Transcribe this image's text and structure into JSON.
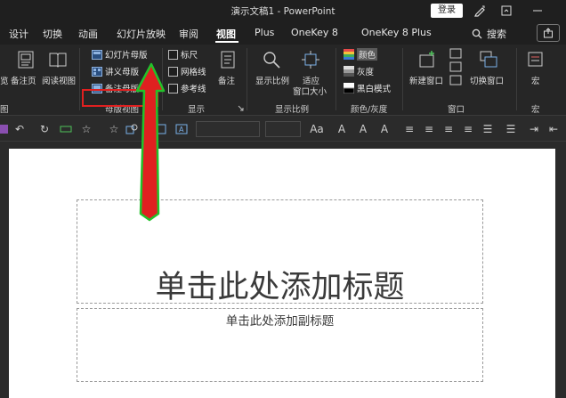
{
  "titlebar": {
    "title": "演示文稿1  -  PowerPoint",
    "login": "登录"
  },
  "tabs": [
    {
      "label": "设计"
    },
    {
      "label": "切换"
    },
    {
      "label": "动画"
    },
    {
      "label": "幻灯片放映"
    },
    {
      "label": "审阅"
    },
    {
      "label": "视图"
    },
    {
      "label": "Plus"
    },
    {
      "label": "OneKey 8"
    },
    {
      "label": "OneKey 8 Plus"
    },
    {
      "label": "搜索"
    }
  ],
  "ribbon": {
    "views": {
      "truncated": "览",
      "notes_page": "备注页",
      "reading_view": "阅读视图",
      "group_label_trunc": "图"
    },
    "master": {
      "slide_master": "幻灯片母版",
      "handout_master": "讲义母版",
      "notes_master": "备注母版",
      "group_label": "母版视图"
    },
    "show": {
      "ruler": "标尺",
      "gridlines": "网格线",
      "guides": "参考线",
      "group_label": "显示"
    },
    "notes": {
      "label": "备注"
    },
    "zoom": {
      "zoom": "显示比例",
      "fit_line1": "适应",
      "fit_line2": "窗口大小",
      "group_label": "显示比例"
    },
    "color": {
      "color": "颜色",
      "grayscale": "灰度",
      "bw": "黑白模式",
      "group_label": "颜色/灰度"
    },
    "window": {
      "new_window": "新建窗口",
      "switch_window": "切换窗口",
      "group_label": "窗口"
    },
    "macros": {
      "label": "宏",
      "group_label": "宏"
    }
  },
  "slide": {
    "title": "单击此处添加标题",
    "subtitle": "单击此处添加副标题"
  },
  "colors": {
    "highlight": "#e02020",
    "arrow_fill": "#e02020",
    "arrow_stroke": "#22c22a"
  },
  "icons": [
    "save-icon",
    "undo-icon",
    "redo-icon",
    "star-icon",
    "search-icon",
    "share-icon",
    "dialog-launcher-icon"
  ]
}
